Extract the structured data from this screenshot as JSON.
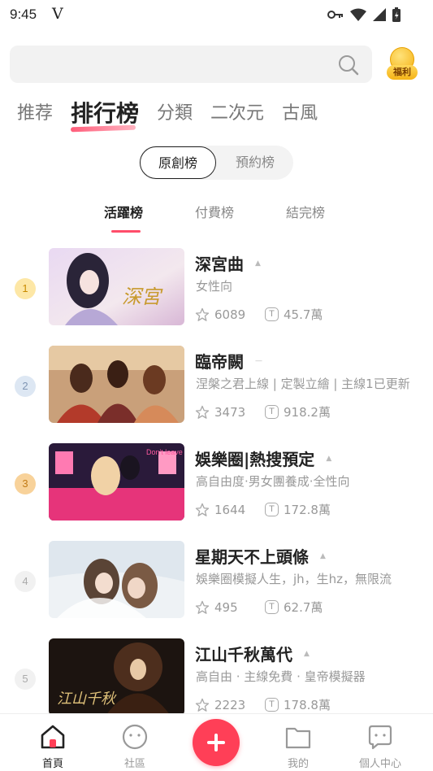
{
  "status_bar": {
    "time": "9:45",
    "carrier_mark": "V"
  },
  "search": {
    "placeholder": ""
  },
  "welfare": {
    "label": "福利"
  },
  "top_tabs": [
    {
      "label": "推荐",
      "active": false
    },
    {
      "label": "排行榜",
      "active": true
    },
    {
      "label": "分類",
      "active": false
    },
    {
      "label": "二次元",
      "active": false
    },
    {
      "label": "古風",
      "active": false
    }
  ],
  "segment": {
    "left": "原創榜",
    "right": "預約榜",
    "selected": "原創榜"
  },
  "sub_tabs": [
    {
      "label": "活躍榜",
      "active": true
    },
    {
      "label": "付費榜",
      "active": false
    },
    {
      "label": "結完榜",
      "active": false
    }
  ],
  "items": [
    {
      "rank": "1",
      "title": "深宮曲",
      "trend": "up",
      "desc": "女性向",
      "stars": "6089",
      "tickets": "45.7萬"
    },
    {
      "rank": "2",
      "title": "臨帝闕",
      "trend": "flat",
      "desc": "涅槃之君上線 | 定製立繪 | 主線1已更新",
      "stars": "3473",
      "tickets": "918.2萬"
    },
    {
      "rank": "3",
      "title": "娛樂圈|熱搜預定",
      "trend": "up",
      "desc": "高自由度·男女團養成·全性向",
      "stars": "1644",
      "tickets": "172.8萬"
    },
    {
      "rank": "4",
      "title": "星期天不上頭條",
      "trend": "up",
      "desc": "娛樂圈模擬人生，jh，生hz，無限流",
      "stars": "495",
      "tickets": "62.7萬"
    },
    {
      "rank": "5",
      "title": "江山千秋萬代",
      "trend": "up",
      "desc": "高自由 · 主線免費 · 皇帝模擬器",
      "stars": "2223",
      "tickets": "178.8萬"
    }
  ],
  "bottom_nav": [
    {
      "label": "首頁",
      "active": true
    },
    {
      "label": "社區",
      "active": false
    },
    {
      "label": "我的",
      "active": false
    },
    {
      "label": "個人中心",
      "active": false
    }
  ],
  "colors": {
    "accent": "#ff3f57",
    "rank1": "#fde7a6",
    "rank2": "#dde7f3",
    "rank3": "#f8d29a",
    "rank_other": "#f1f1f1"
  }
}
